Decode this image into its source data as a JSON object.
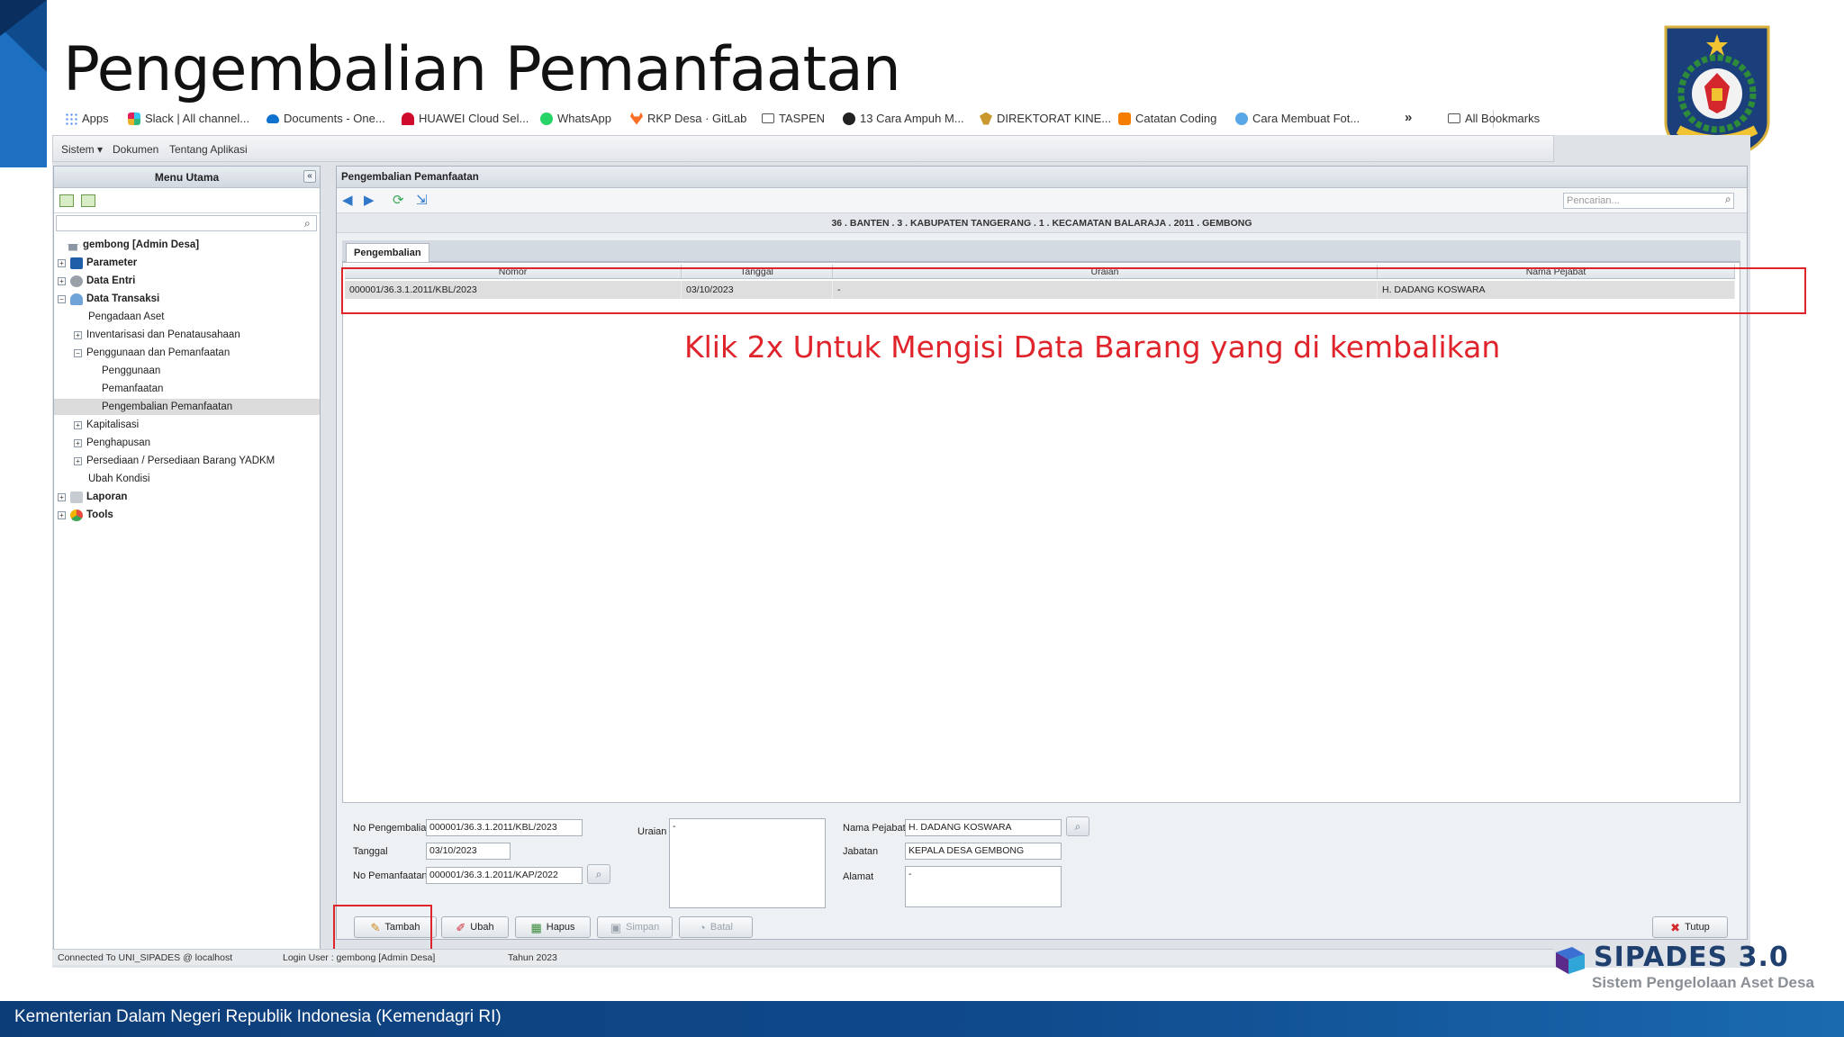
{
  "slide": {
    "title": "Pengembalian Pemanfaatan",
    "annotation": "Klik 2x Untuk Mengisi Data Barang yang di kembalikan",
    "footer": "Kementerian Dalam Negeri Republik Indonesia (Kemendagri RI)",
    "colors": {
      "accent_red": "#e0242b",
      "footer_blue": "#0f4a8c"
    }
  },
  "bookmarks": {
    "items": [
      {
        "label": "Apps",
        "icon": "apps-grid-icon"
      },
      {
        "label": "Slack | All channel...",
        "icon": "slack-icon"
      },
      {
        "label": "Documents - One...",
        "icon": "onedrive-cloud-icon"
      },
      {
        "label": "HUAWEI Cloud Sel...",
        "icon": "huawei-icon"
      },
      {
        "label": "WhatsApp",
        "icon": "whatsapp-icon"
      },
      {
        "label": "RKP Desa · GitLab",
        "icon": "gitlab-icon"
      },
      {
        "label": "TASPEN",
        "icon": "folder-icon"
      },
      {
        "label": "13 Cara Ampuh M...",
        "icon": "site-icon"
      },
      {
        "label": "DIREKTORAT KINE...",
        "icon": "garuda-icon"
      },
      {
        "label": "Catatan Coding",
        "icon": "blogger-icon"
      },
      {
        "label": "Cara Membuat Fot...",
        "icon": "site-icon"
      }
    ],
    "more": "»",
    "all_bookmarks": "All Bookmarks"
  },
  "menubar": {
    "sistem": "Sistem ▾",
    "dokumen": "Dokumen",
    "tentang": "Tentang Aplikasi"
  },
  "left_panel": {
    "title": "Menu Utama",
    "collapse": "«",
    "tree": [
      "gembong [Admin Desa]",
      "Parameter",
      "Data Entri",
      "Data Transaksi",
      "Pengadaan Aset",
      "Inventarisasi dan Penatausahaan",
      "Penggunaan dan Pemanfaatan",
      "Penggunaan",
      "Pemanfaatan",
      "Pengembalian Pemanfaatan",
      "Kapitalisasi",
      "Penghapusan",
      "Persediaan / Persediaan Barang YADKM",
      "Ubah Kondisi",
      "Laporan",
      "Tools"
    ]
  },
  "main": {
    "panel_title": "Pengembalian Pemanfaatan",
    "search_placeholder": "Pencarian...",
    "location": "36 . BANTEN . 3 . KABUPATEN TANGERANG . 1 . KECAMATAN BALARAJA . 2011 . GEMBONG",
    "tab": "Pengembalian",
    "table": {
      "columns": [
        "Nomor",
        "Tanggal",
        "Uraian",
        "Nama Pejabat"
      ],
      "rows": [
        [
          "000001/36.3.1.2011/KBL/2023",
          "03/10/2023",
          "-",
          "H. DADANG KOSWARA"
        ]
      ]
    }
  },
  "form": {
    "no_pengembalian_label": "No Pengembalian",
    "no_pengembalian": "000001/36.3.1.2011/KBL/2023",
    "tanggal_label": "Tanggal",
    "tanggal": "03/10/2023",
    "no_pemanfaatan_label": "No Pemanfaatan",
    "no_pemanfaatan": "000001/36.3.1.2011/KAP/2022",
    "uraian_label": "Uraian",
    "uraian": "-",
    "nama_pejabat_label": "Nama Pejabat",
    "nama_pejabat": "H. DADANG KOSWARA",
    "jabatan_label": "Jabatan",
    "jabatan": "KEPALA DESA GEMBONG",
    "alamat_label": "Alamat",
    "alamat": "-"
  },
  "buttons": {
    "tambah": "Tambah",
    "ubah": "Ubah",
    "hapus": "Hapus",
    "simpan": "Simpan",
    "batal": "Batal",
    "tutup": "Tutup"
  },
  "status": {
    "connection": "Connected To UNI_SIPADES @ localhost",
    "login": "Login User : gembong [Admin Desa]",
    "tahun": "Tahun 2023"
  },
  "sipades": {
    "name": "SIPADES 3.0",
    "subtitle": "Sistem Pengelolaan Aset Desa"
  }
}
